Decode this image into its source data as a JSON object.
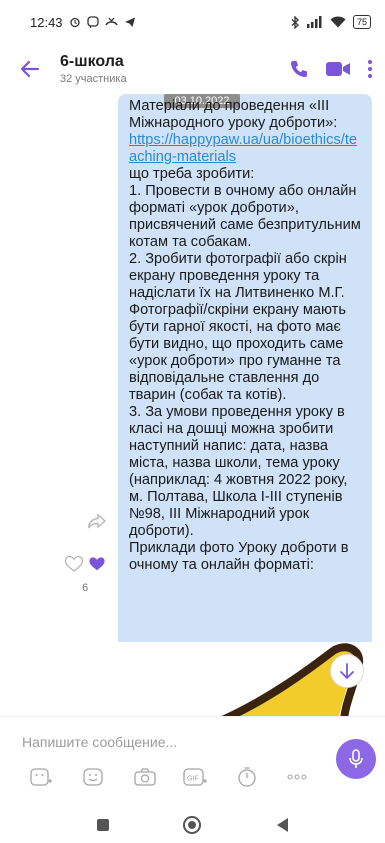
{
  "status": {
    "time": "12:43",
    "battery": "75"
  },
  "header": {
    "title": "6-школа",
    "subtitle": "32 участника"
  },
  "chat": {
    "date": "03.10.2022",
    "message_before_link": "Матеріали до проведення «III Міжнародного уроку доброти»:\n",
    "link": "https://happypaw.ua/ua/bioethics/teaching-materials",
    "message_after_link": "\nщо треба зробити:\n1. Провести в очному або онлайн форматі «урок доброти», присвячений саме безпритульним котам та собакам.\n2. Зробити фотографії або скрін екрану проведення уроку та надіслати їх на Литвиненко М.Г. Фотографії/скріни екрану мають бути гарної якості, на фото має бути видно, що проходить саме «урок доброти» про гуманне та відповідальне ставлення до тварин (собак та котів).\n3. За умови проведення уроку в класі на дошці можна зробити наступний напис: дата, назва міста, назва школи, тема уроку (наприклад: 4 жовтня 2022 року, м. Полтава, Школа І-ІІІ ступенів №98, ІІІ Міжнародний урок доброти).\nПриклади фото Уроку доброти в очному та онлайн форматі:",
    "like_count": "6"
  },
  "composer": {
    "placeholder": "Напишите сообщение..."
  },
  "colors": {
    "accent": "#7b55d9",
    "bubble": "#cfe2f8",
    "link": "#2a8bd0",
    "mic": "#8c68e6"
  },
  "icons": [
    "back-arrow-icon",
    "phone-icon",
    "video-icon",
    "more-icon",
    "share-icon",
    "heart-outline-icon",
    "heart-filled-icon",
    "arrow-down-icon",
    "sticker-icon",
    "emoji-icon",
    "camera-icon",
    "gif-icon",
    "timer-icon",
    "more-dots-icon",
    "mic-icon"
  ]
}
